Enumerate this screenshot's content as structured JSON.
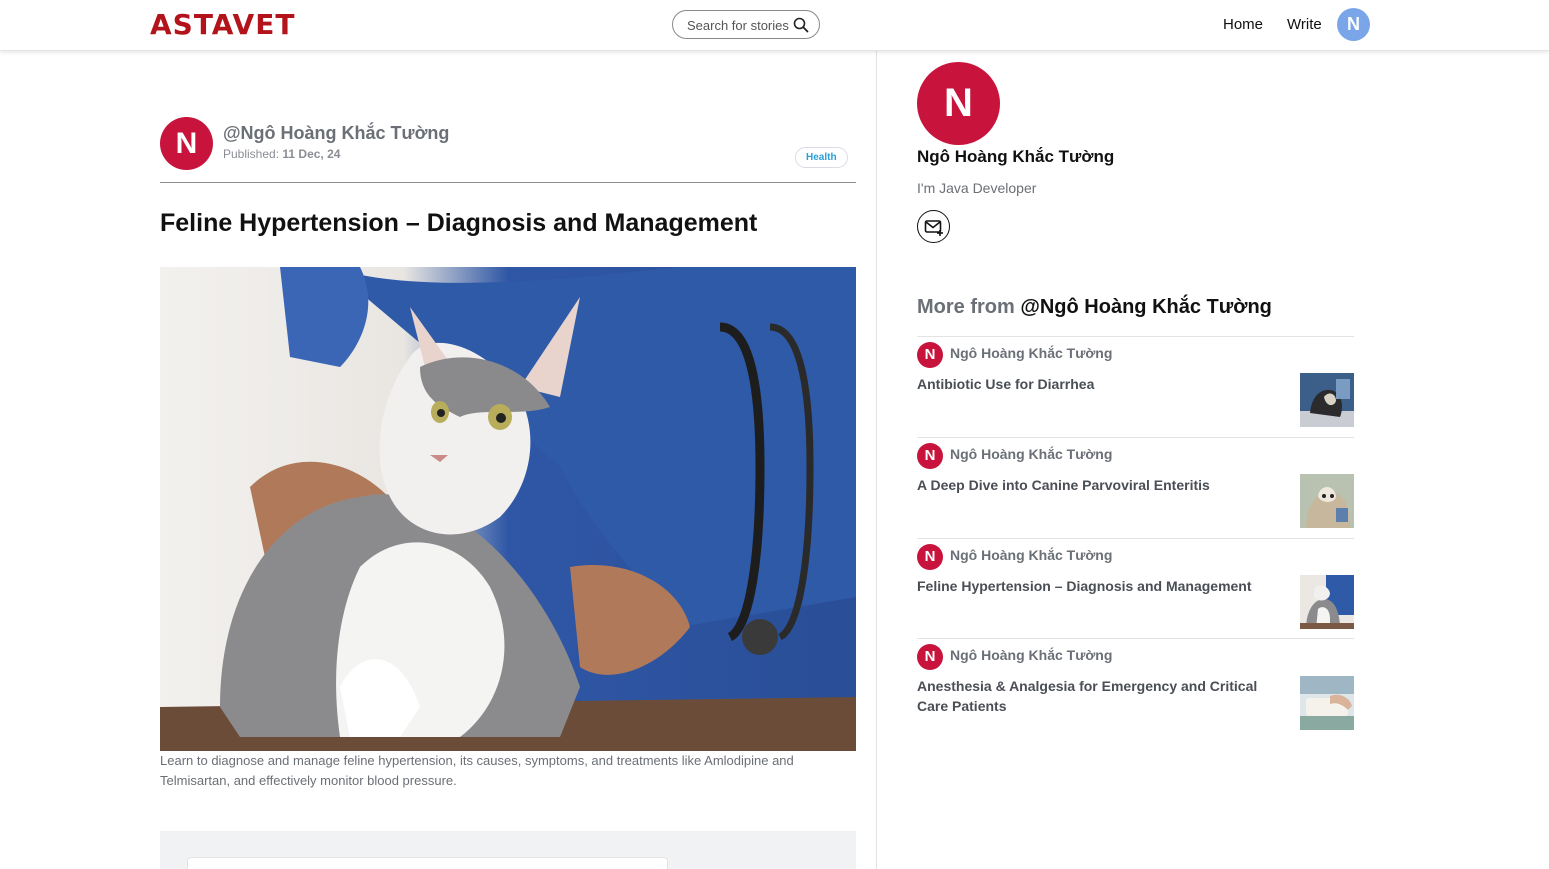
{
  "header": {
    "logo": "ASTAVET",
    "search_placeholder": "Search for stories",
    "nav_home": "Home",
    "nav_write": "Write",
    "user_initial": "N"
  },
  "article": {
    "author_initial": "N",
    "author_handle": "@Ngô Hoàng Khắc Tường",
    "published_label": "Published:",
    "published_date": "11 Dec, 24",
    "tag": "Health",
    "title": "Feline Hypertension – Diagnosis and Management",
    "caption": "Learn to diagnose and manage feline hypertension, its causes, symptoms, and treatments like Amlodipine and Telmisartan, and effectively monitor blood pressure."
  },
  "sidebar": {
    "profile_initial": "N",
    "profile_name": "Ngô Hoàng Khắc Tường",
    "profile_bio": "I'm Java Developer",
    "more_prefix": "More from",
    "more_name": "@Ngô Hoàng Khắc Tường",
    "stories": [
      {
        "initial": "N",
        "author": "Ngô Hoàng Khắc Tường",
        "title": "Antibiotic Use for Diarrhea"
      },
      {
        "initial": "N",
        "author": "Ngô Hoàng Khắc Tường",
        "title": "A Deep Dive into Canine Parvoviral Enteritis"
      },
      {
        "initial": "N",
        "author": "Ngô Hoàng Khắc Tường",
        "title": "Feline Hypertension – Diagnosis and Management"
      },
      {
        "initial": "N",
        "author": "Ngô Hoàng Khắc Tường",
        "title": "Anesthesia & Analgesia for Emergency and Critical Care Patients"
      }
    ]
  },
  "colors": {
    "brand_red": "#b3141b",
    "avatar_red": "#c8143c",
    "user_avatar_blue": "#7aa6e9",
    "tag_blue": "#2a9fd8"
  },
  "icons": {
    "search": "search-icon",
    "mail": "mail-plus-icon"
  }
}
